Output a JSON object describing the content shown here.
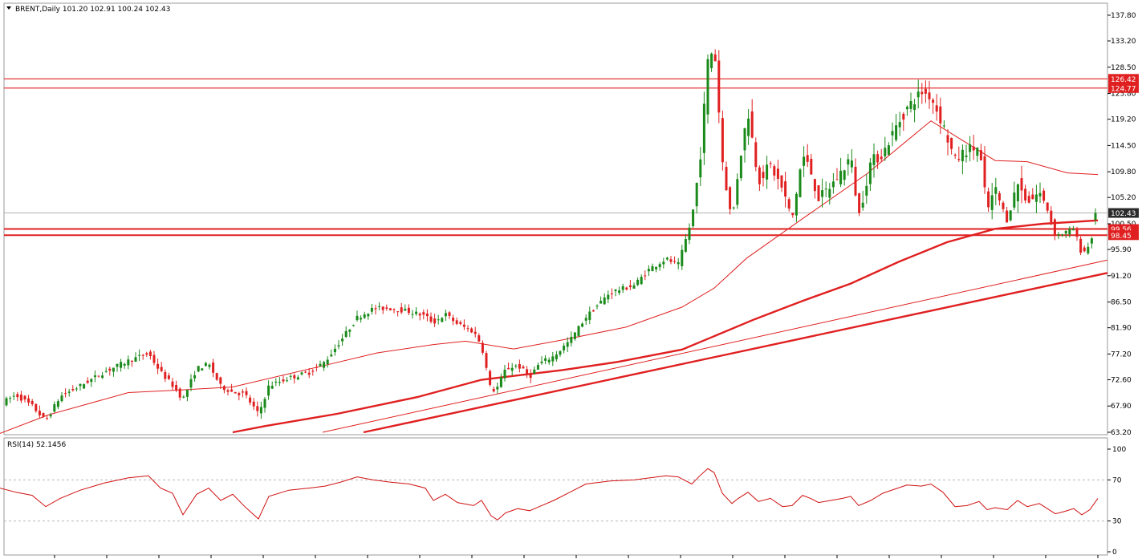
{
  "header": {
    "symbol_line": "BRENT,Daily  101.20 102.91 100.24 102.43",
    "arrow_icon": "triangle-down-icon"
  },
  "rsi_header": "RSI(14) 52.1456",
  "colors": {
    "bull": "#1a8a1a",
    "bear": "#e02020",
    "line": "#e02020",
    "grid": "#b8b8b8",
    "price_tag": "#2a2a2a",
    "level_tag": "#e02020",
    "rsi_line": "#d01010"
  },
  "chart_data": [
    {
      "type": "candlestick",
      "title": "BRENT,Daily",
      "ylim": [
        63.2,
        138.8
      ],
      "y_ticks": [
        "137.80",
        "133.20",
        "128.50",
        "123.80",
        "119.20",
        "114.50",
        "109.80",
        "105.20",
        "100.50",
        "95.90",
        "91.20",
        "86.50",
        "81.90",
        "77.20",
        "72.60",
        "67.90",
        "63.20"
      ],
      "price_tag": "102.43",
      "levels": [
        {
          "label": "126.42",
          "value": 126.42
        },
        {
          "label": "124.77",
          "value": 124.77
        },
        {
          "label": "99.56",
          "value": 99.56
        },
        {
          "label": "98.45",
          "value": 98.45
        }
      ],
      "series": [
        {
          "name": "MA fast",
          "style": "thin",
          "values": [
            [
              0,
              63.0
            ],
            [
              60,
              66.3
            ],
            [
              160,
              70.3
            ],
            [
              230,
              70.8
            ],
            [
              290,
              71.3
            ],
            [
              400,
              75.0
            ],
            [
              470,
              77.4
            ],
            [
              540,
              78.9
            ],
            [
              580,
              79.5
            ],
            [
              640,
              78.1
            ],
            [
              700,
              79.7
            ],
            [
              780,
              82.0
            ],
            [
              850,
              85.6
            ],
            [
              890,
              89.0
            ],
            [
              930,
              94.3
            ],
            [
              1000,
              101.4
            ],
            [
              1080,
              109.4
            ],
            [
              1160,
              118.9
            ],
            [
              1240,
              111.8
            ],
            [
              1280,
              111.6
            ],
            [
              1330,
              109.6
            ],
            [
              1368,
              109.3
            ]
          ]
        },
        {
          "name": "MA slow",
          "style": "thick",
          "values": [
            [
              290,
              63.2
            ],
            [
              330,
              64.3
            ],
            [
              420,
              66.5
            ],
            [
              520,
              69.5
            ],
            [
              600,
              72.6
            ],
            [
              700,
              74.3
            ],
            [
              770,
              75.8
            ],
            [
              850,
              78.0
            ],
            [
              880,
              79.8
            ],
            [
              940,
              83.4
            ],
            [
              1000,
              86.7
            ],
            [
              1060,
              89.8
            ],
            [
              1120,
              93.7
            ],
            [
              1180,
              97.2
            ],
            [
              1240,
              99.6
            ],
            [
              1300,
              100.5
            ],
            [
              1368,
              101.1
            ]
          ]
        },
        {
          "name": "Trendline 1",
          "style": "thin",
          "values": [
            [
              402,
              63.2
            ],
            [
              1380,
              94.0
            ]
          ]
        },
        {
          "name": "Trendline 2",
          "style": "thick",
          "values": [
            [
              453,
              63.2
            ],
            [
              1380,
              91.7
            ]
          ]
        }
      ],
      "anchors": [
        [
          0,
          68.3
        ],
        [
          20,
          69.9
        ],
        [
          40,
          67.9
        ],
        [
          57,
          65.2
        ],
        [
          75,
          69.6
        ],
        [
          100,
          71.5
        ],
        [
          130,
          74.0
        ],
        [
          160,
          76.0
        ],
        [
          185,
          77.3
        ],
        [
          200,
          74.0
        ],
        [
          215,
          71.6
        ],
        [
          228,
          69.1
        ],
        [
          245,
          74.6
        ],
        [
          260,
          75.4
        ],
        [
          275,
          71.4
        ],
        [
          290,
          70.4
        ],
        [
          305,
          70.0
        ],
        [
          322,
          66.4
        ],
        [
          335,
          71.5
        ],
        [
          360,
          72.9
        ],
        [
          385,
          73.9
        ],
        [
          405,
          75.8
        ],
        [
          425,
          79.7
        ],
        [
          445,
          83.7
        ],
        [
          465,
          85.3
        ],
        [
          485,
          85.4
        ],
        [
          510,
          84.8
        ],
        [
          530,
          84.0
        ],
        [
          540,
          82.8
        ],
        [
          555,
          84.3
        ],
        [
          570,
          82.6
        ],
        [
          590,
          81.2
        ],
        [
          600,
          78.8
        ],
        [
          612,
          70.4
        ],
        [
          620,
          71.3
        ],
        [
          630,
          74.5
        ],
        [
          645,
          75.2
        ],
        [
          660,
          73.1
        ],
        [
          672,
          75.5
        ],
        [
          690,
          76.8
        ],
        [
          710,
          79.6
        ],
        [
          730,
          83.8
        ],
        [
          760,
          88.2
        ],
        [
          790,
          89.5
        ],
        [
          810,
          92.5
        ],
        [
          830,
          94.2
        ],
        [
          845,
          93.1
        ],
        [
          862,
          101.3
        ],
        [
          872,
          111.6
        ],
        [
          882,
          129.4
        ],
        [
          890,
          132.4
        ],
        [
          900,
          112.0
        ],
        [
          912,
          100.7
        ],
        [
          920,
          110.4
        ],
        [
          932,
          120.7
        ],
        [
          945,
          108.3
        ],
        [
          960,
          111.0
        ],
        [
          975,
          106.6
        ],
        [
          987,
          101.3
        ],
        [
          1000,
          112.8
        ],
        [
          1010,
          110.0
        ],
        [
          1020,
          104.8
        ],
        [
          1035,
          107.2
        ],
        [
          1050,
          110.1
        ],
        [
          1060,
          112.6
        ],
        [
          1070,
          101.9
        ],
        [
          1085,
          111.6
        ],
        [
          1100,
          113.0
        ],
        [
          1115,
          117.5
        ],
        [
          1130,
          121.1
        ],
        [
          1148,
          124.1
        ],
        [
          1160,
          123.3
        ],
        [
          1175,
          118.2
        ],
        [
          1190,
          111.7
        ],
        [
          1205,
          113.8
        ],
        [
          1220,
          114.1
        ],
        [
          1230,
          102.8
        ],
        [
          1240,
          106.7
        ],
        [
          1255,
          101.0
        ],
        [
          1268,
          107.9
        ],
        [
          1280,
          104.2
        ],
        [
          1295,
          106.2
        ],
        [
          1305,
          103.1
        ],
        [
          1315,
          98.4
        ],
        [
          1325,
          98.8
        ],
        [
          1338,
          99.6
        ],
        [
          1348,
          95.1
        ],
        [
          1358,
          96.8
        ],
        [
          1368,
          102.43
        ]
      ]
    },
    {
      "type": "line",
      "title": "RSI(14) 52.1456",
      "ylim": [
        0,
        100
      ],
      "y_ticks": [
        "100",
        "70",
        "30",
        "0"
      ],
      "levels": [
        70,
        30
      ],
      "x": [
        0,
        20,
        40,
        57,
        75,
        100,
        130,
        160,
        185,
        200,
        215,
        228,
        245,
        260,
        275,
        290,
        305,
        322,
        335,
        360,
        385,
        405,
        425,
        445,
        465,
        485,
        510,
        530,
        540,
        555,
        570,
        590,
        600,
        612,
        620,
        630,
        645,
        660,
        672,
        690,
        710,
        730,
        760,
        790,
        810,
        830,
        845,
        862,
        872,
        882,
        890,
        900,
        912,
        920,
        932,
        945,
        960,
        975,
        987,
        1000,
        1010,
        1020,
        1035,
        1050,
        1060,
        1070,
        1085,
        1100,
        1115,
        1130,
        1148,
        1160,
        1175,
        1190,
        1205,
        1220,
        1230,
        1240,
        1255,
        1268,
        1280,
        1295,
        1305,
        1315,
        1325,
        1338,
        1348,
        1358,
        1368
      ],
      "values": [
        62,
        58,
        55,
        44,
        52,
        60,
        67,
        72,
        74,
        62,
        57,
        36,
        56,
        62,
        50,
        56,
        44,
        32,
        54,
        60,
        62,
        64,
        68,
        73,
        70,
        68,
        66,
        62,
        50,
        56,
        48,
        45,
        50,
        35,
        31,
        38,
        42,
        40,
        44,
        50,
        58,
        66,
        69,
        70,
        72,
        74,
        73,
        66,
        74,
        81,
        77,
        57,
        47,
        52,
        58,
        49,
        52,
        44,
        45,
        55,
        52,
        48,
        50,
        52,
        54,
        45,
        50,
        57,
        61,
        65,
        64,
        66,
        58,
        44,
        45,
        49,
        41,
        43,
        41,
        50,
        44,
        47,
        42,
        37,
        39,
        42,
        36,
        41,
        52
      ]
    }
  ]
}
